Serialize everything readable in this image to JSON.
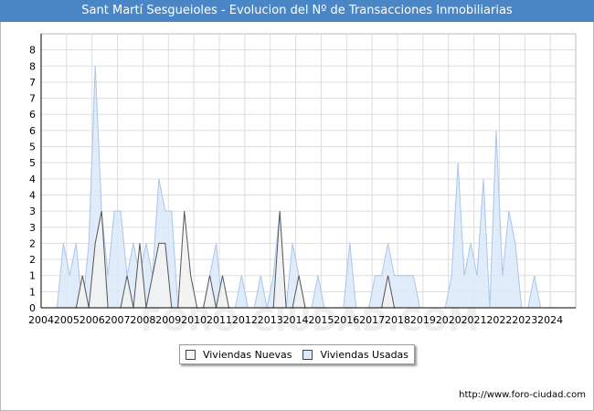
{
  "header": {
    "title": "Sant Martí Sesgueioles - Evolucion del Nº de Transacciones Inmobiliarias"
  },
  "footer": {
    "url": "http://www.foro-ciudad.com"
  },
  "watermark": "FORO-CIUDAD.COM",
  "colors": {
    "header_bg": "#4a86c5",
    "nuevas_fill": "#f2f2f2",
    "nuevas_line": "#555555",
    "usadas_fill": "#dbe9f9",
    "usadas_line": "#a9c6ea",
    "grid": "#dddddd"
  },
  "chart_data": {
    "type": "area",
    "title": "Sant Martí Sesgueioles - Evolucion del Nº de Transacciones Inmobiliarias",
    "xlabel": "",
    "ylabel": "",
    "x_tick_labels": [
      "2004",
      "2005",
      "2006",
      "2007",
      "2008",
      "2009",
      "2010",
      "2011",
      "2012",
      "2013",
      "2014",
      "2015",
      "2016",
      "2017",
      "2018",
      "2019",
      "2020",
      "2021",
      "2022",
      "2023",
      "2024"
    ],
    "y_tick_labels": [
      "0",
      "1",
      "1",
      "2",
      "2",
      "3",
      "3",
      "4",
      "4",
      "5",
      "5",
      "6",
      "6",
      "7",
      "7",
      "8",
      "8"
    ],
    "ylim": [
      0,
      8.5
    ],
    "grid": true,
    "legend_position": "bottom",
    "period": "quarterly",
    "series": [
      {
        "name": "Viviendas Nuevas",
        "values": [
          0,
          0,
          0,
          0,
          0,
          0,
          1,
          0,
          2,
          3,
          0,
          0,
          0,
          1,
          0,
          2,
          0,
          1,
          2,
          2,
          0,
          0,
          3,
          1,
          0,
          0,
          1,
          0,
          1,
          0,
          0,
          0,
          0,
          0,
          0,
          0,
          0,
          3,
          0,
          0,
          1,
          0,
          0,
          0,
          0,
          0,
          0,
          0,
          0,
          0,
          0,
          0,
          0,
          0,
          1,
          0,
          0,
          0,
          0,
          0,
          0,
          0,
          0,
          0,
          0,
          0,
          0,
          0,
          0,
          0,
          0,
          0,
          0,
          0,
          0,
          0,
          0,
          0,
          0,
          0,
          0,
          0,
          0,
          0
        ]
      },
      {
        "name": "Viviendas Usadas",
        "values": [
          0,
          0,
          0,
          2,
          1,
          2,
          0,
          2,
          7.5,
          3,
          1,
          3,
          3,
          1,
          2,
          1,
          2,
          1,
          4,
          3,
          3,
          0,
          0,
          0,
          0,
          0,
          1,
          2,
          0,
          0,
          0,
          1,
          0,
          0,
          1,
          0,
          1,
          3,
          0,
          2,
          1,
          0,
          0,
          1,
          0,
          0,
          0,
          0,
          2,
          0,
          0,
          0,
          1,
          1,
          2,
          1,
          1,
          1,
          1,
          0,
          0,
          0,
          0,
          0,
          1,
          4.5,
          1,
          2,
          1,
          4,
          0,
          5.5,
          1,
          3,
          2,
          0,
          0,
          1,
          0,
          0
        ]
      }
    ]
  }
}
